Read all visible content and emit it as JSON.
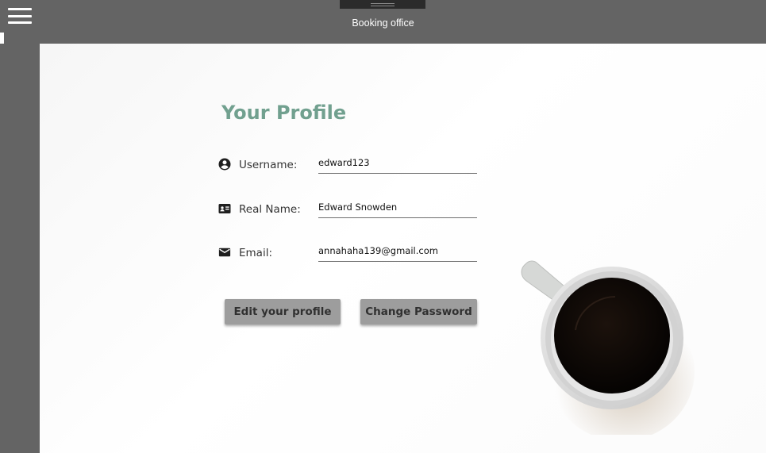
{
  "app": {
    "title": "Booking office"
  },
  "profile": {
    "heading": "Your Profile",
    "fields": [
      {
        "label": "Username:",
        "value": "edward123",
        "icon": "account-circle-icon"
      },
      {
        "label": "Real Name:",
        "value": "Edward Snowden",
        "icon": "id-card-icon"
      },
      {
        "label": "Email:",
        "value": "annahaha139@gmail.com",
        "icon": "mail-icon"
      }
    ],
    "buttons": {
      "edit_label": "Edit your profile",
      "change_password_label": "Change Password"
    }
  },
  "colors": {
    "chrome": "#646464",
    "heading": "#71a08f",
    "button": "#9d9d9d"
  }
}
